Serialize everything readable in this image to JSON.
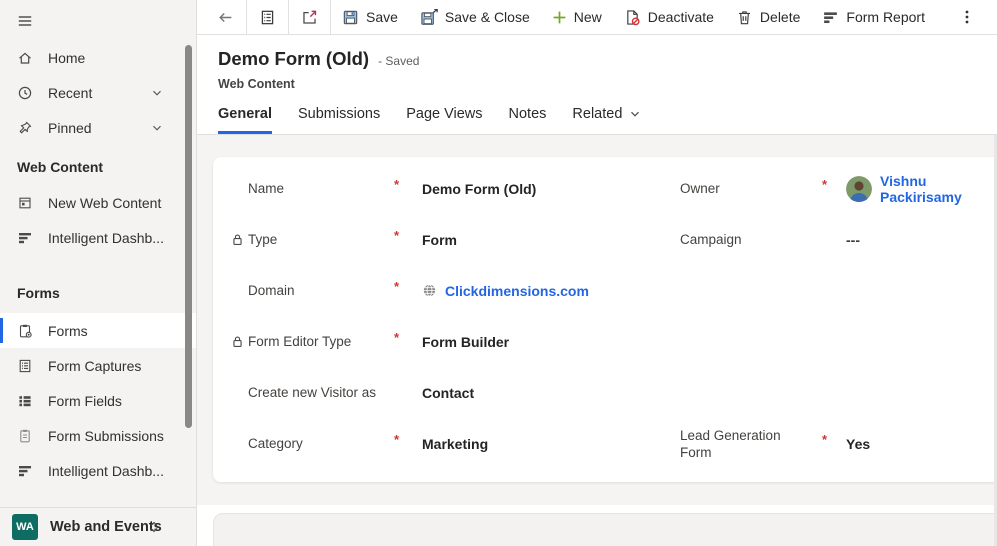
{
  "ui": {
    "required_marker": "*"
  },
  "colors": {
    "accent": "#2266e3",
    "link": "#2266e3",
    "required": "#d13438",
    "area_badge": "#0f6c63",
    "new_plus_green": "#73aa24",
    "deactivate_red": "#d13438",
    "save_floppy_blue": "#9dc3ea"
  },
  "sidebar": {
    "nav": [
      {
        "label": "Home"
      },
      {
        "label": "Recent"
      },
      {
        "label": "Pinned"
      }
    ],
    "groups": [
      {
        "header": "Web Content",
        "items": [
          {
            "label": "New Web Content"
          },
          {
            "label": "Intelligent Dashb..."
          }
        ]
      },
      {
        "header": "Forms",
        "items": [
          {
            "label": "Forms",
            "selected": true
          },
          {
            "label": "Form Captures"
          },
          {
            "label": "Form Fields"
          },
          {
            "label": "Form Submissions"
          },
          {
            "label": "Intelligent Dashb..."
          }
        ]
      }
    ],
    "switcher": {
      "badge": "WA",
      "label": "Web and Events"
    }
  },
  "command_bar": {
    "save": "Save",
    "save_close": "Save & Close",
    "new": "New",
    "deactivate": "Deactivate",
    "delete": "Delete",
    "form_report": "Form Report"
  },
  "header": {
    "title": "Demo Form (Old)",
    "status": "- Saved",
    "entity": "Web Content",
    "tabs": [
      {
        "label": "General",
        "active": true
      },
      {
        "label": "Submissions"
      },
      {
        "label": "Page Views"
      },
      {
        "label": "Notes"
      },
      {
        "label": "Related"
      }
    ]
  },
  "form": {
    "left": [
      {
        "label": "Name",
        "required": true,
        "value": "Demo Form (Old)"
      },
      {
        "label": "Type",
        "required": true,
        "locked": true,
        "value": "Form"
      },
      {
        "label": "Domain",
        "required": true,
        "value": "Clickdimensions.com"
      },
      {
        "label": "Form Editor Type",
        "required": true,
        "locked": true,
        "value": "Form Builder"
      },
      {
        "label": "Create new Visitor as",
        "value": "Contact"
      },
      {
        "label": "Category",
        "required": true,
        "value": "Marketing"
      }
    ],
    "right": [
      {
        "label": "Owner",
        "required": true,
        "value": "Vishnu Packirisamy"
      },
      {
        "label": "Campaign",
        "value": "---"
      },
      {
        "label": "Lead Generation Form",
        "required": true,
        "value": "Yes"
      }
    ]
  }
}
